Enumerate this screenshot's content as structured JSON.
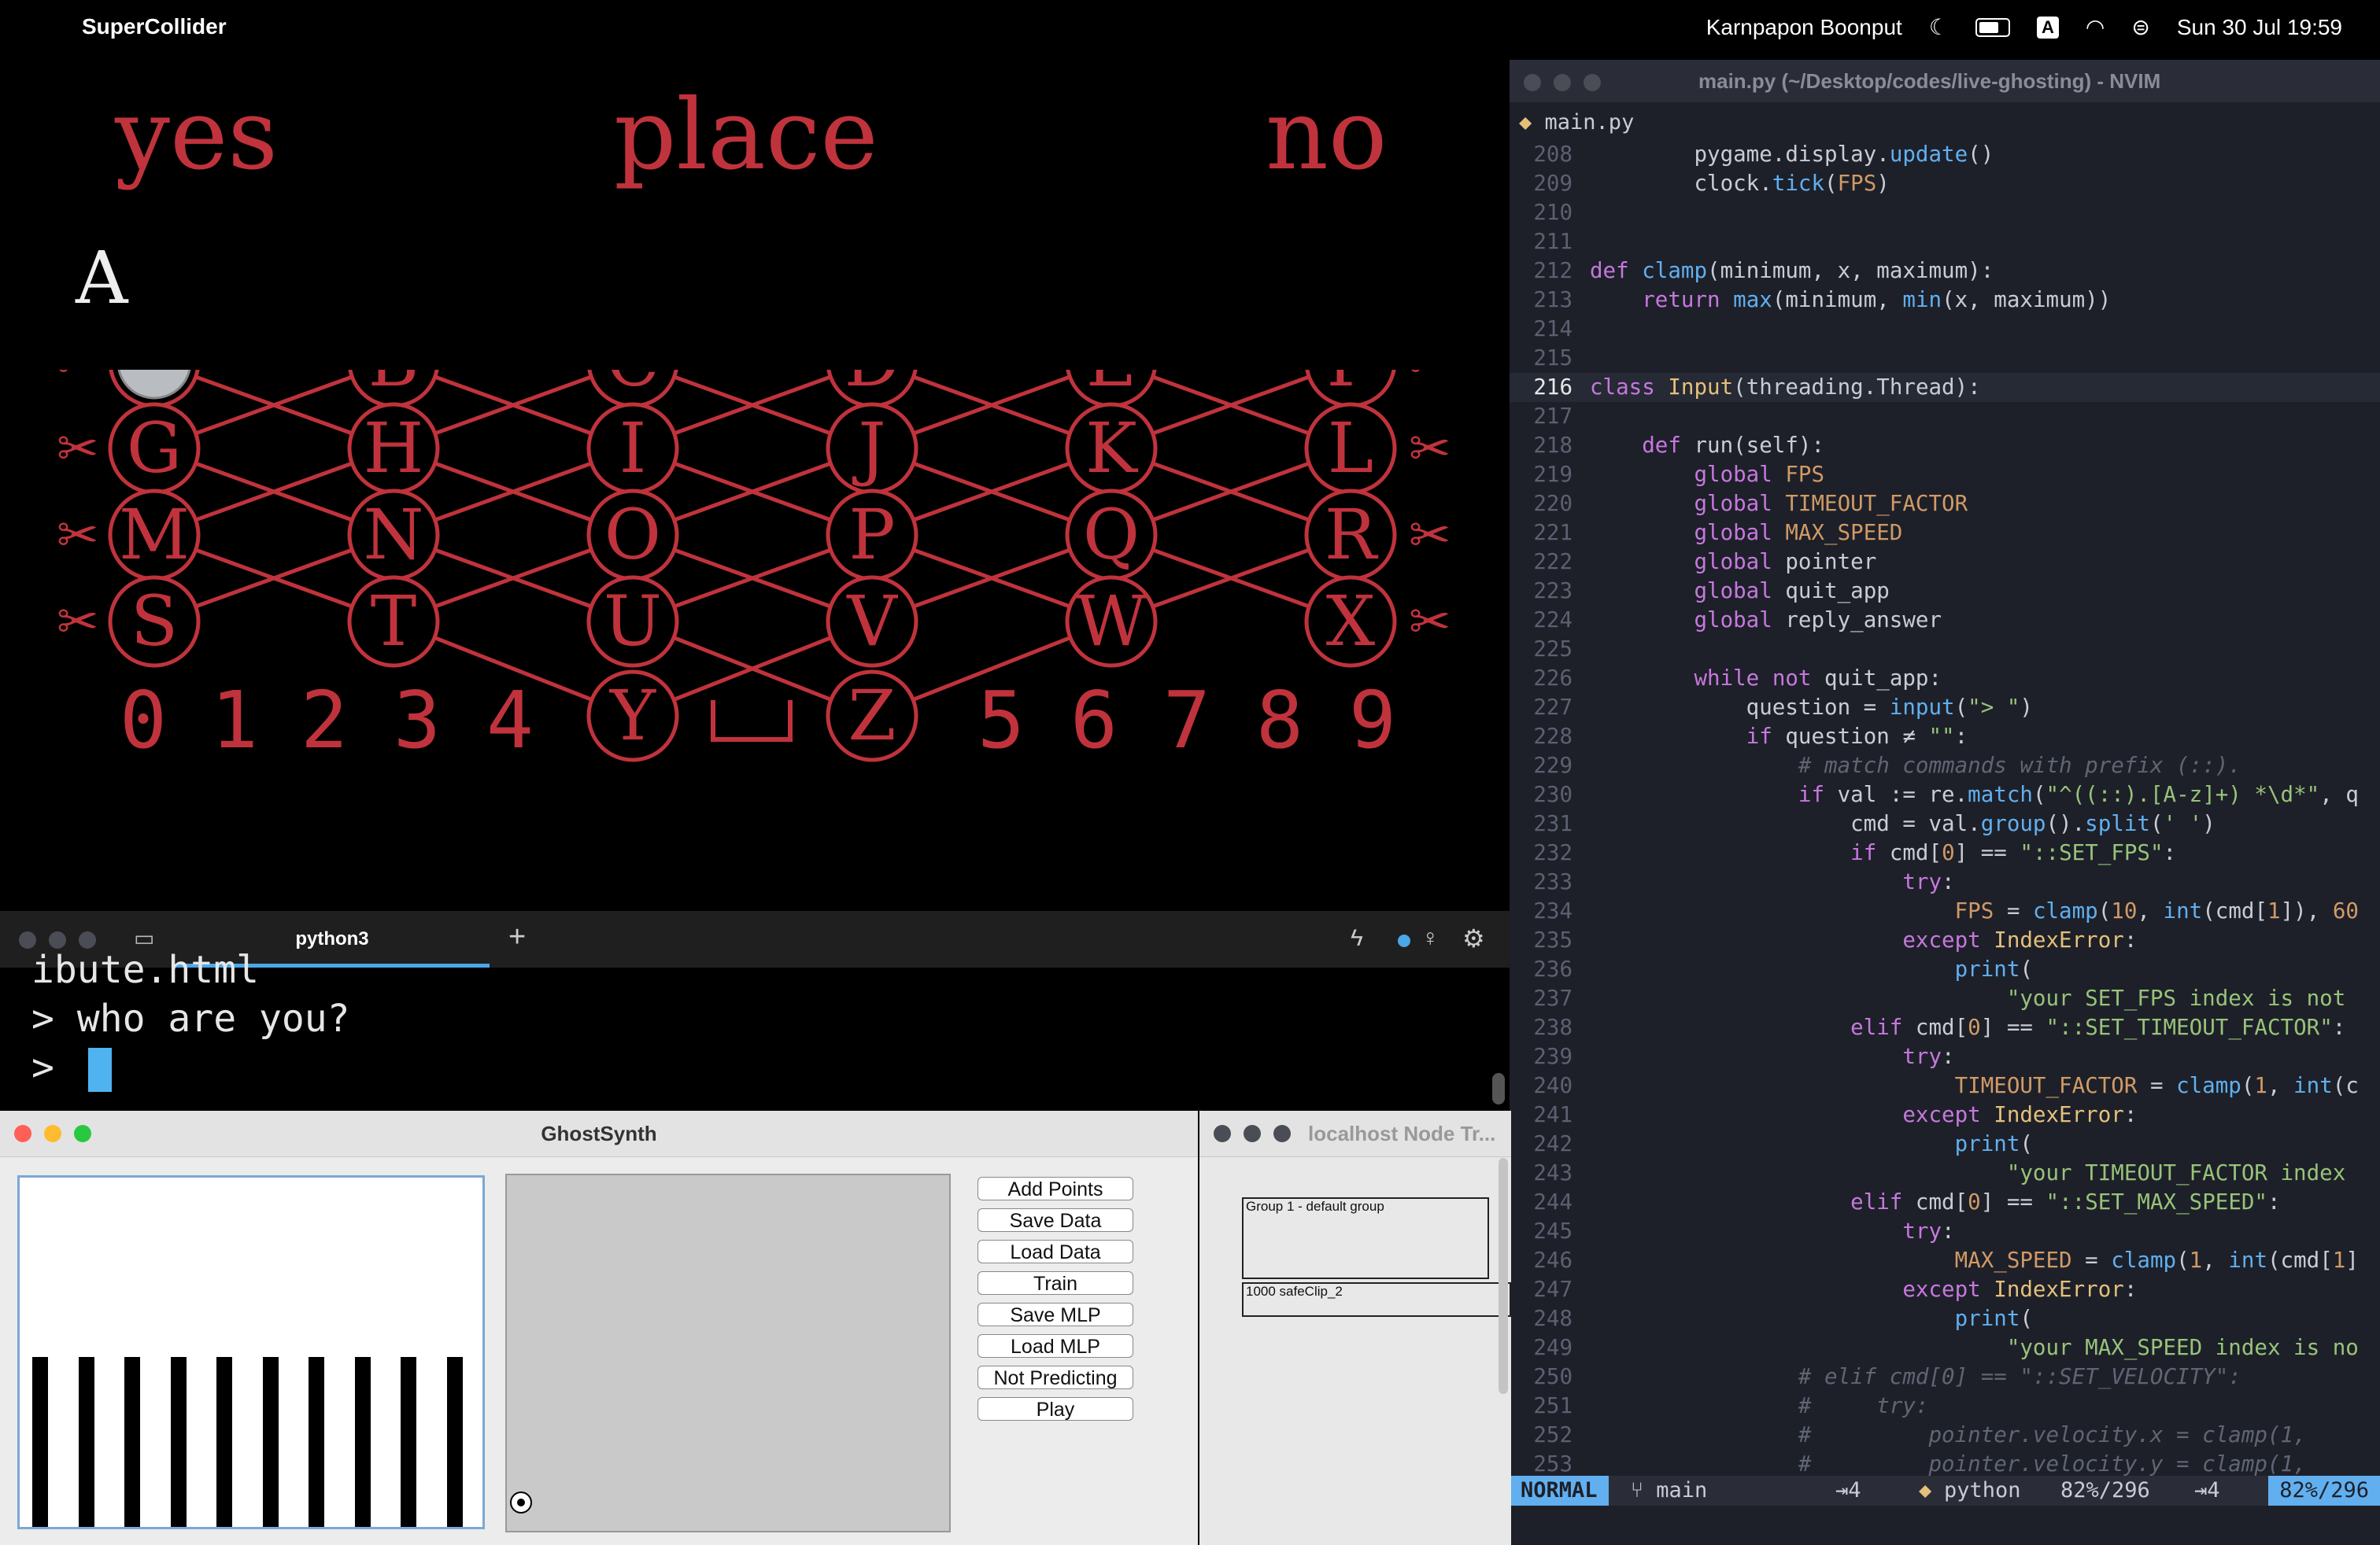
{
  "menubar": {
    "app_name": "SuperCollider",
    "user": "Karnpapon Boonput",
    "keyboard_layout": "A",
    "datetime": "Sun 30 Jul  19:59"
  },
  "game": {
    "words": [
      "yes",
      "place",
      "no"
    ],
    "current_letter": "A",
    "letter_rows": [
      [
        "A",
        "B",
        "C",
        "D",
        "E",
        "F"
      ],
      [
        "G",
        "H",
        "I",
        "J",
        "K",
        "L"
      ],
      [
        "M",
        "N",
        "O",
        "P",
        "Q",
        "R"
      ],
      [
        "S",
        "T",
        "U",
        "V",
        "W",
        "X"
      ]
    ],
    "digits_left": [
      "0",
      "1",
      "2",
      "3",
      "4"
    ],
    "bottom_letters": [
      "Y",
      "Z"
    ],
    "digits_right": [
      "5",
      "6",
      "7",
      "8",
      "9"
    ],
    "accent_color": "#c0333c"
  },
  "nvim": {
    "window_title": "main.py (~/Desktop/codes/live-ghosting) - NVIM",
    "tab_name": "main.py",
    "lines": [
      {
        "n": "208",
        "code": "        pygame.display.update()"
      },
      {
        "n": "209",
        "code": "        clock.tick(FPS)"
      },
      {
        "n": "210",
        "code": ""
      },
      {
        "n": "211",
        "code": ""
      },
      {
        "n": "212",
        "code": "def clamp(minimum, x, maximum):"
      },
      {
        "n": "213",
        "code": "    return max(minimum, min(x, maximum))"
      },
      {
        "n": "214",
        "code": ""
      },
      {
        "n": "215",
        "code": ""
      },
      {
        "n": "216",
        "code": "class Input(threading.Thread):"
      },
      {
        "n": "217",
        "code": ""
      },
      {
        "n": "218",
        "code": "    def run(self):"
      },
      {
        "n": "219",
        "code": "        global FPS"
      },
      {
        "n": "220",
        "code": "        global TIMEOUT_FACTOR"
      },
      {
        "n": "221",
        "code": "        global MAX_SPEED"
      },
      {
        "n": "222",
        "code": "        global pointer"
      },
      {
        "n": "223",
        "code": "        global quit_app"
      },
      {
        "n": "224",
        "code": "        global reply_answer"
      },
      {
        "n": "225",
        "code": ""
      },
      {
        "n": "226",
        "code": "        while not quit_app:"
      },
      {
        "n": "227",
        "code": "            question = input(\"> \")"
      },
      {
        "n": "228",
        "code": "            if question ≠ \"\":"
      },
      {
        "n": "229",
        "code": "                # match commands with prefix (::)."
      },
      {
        "n": "230",
        "code": "                if val := re.match(\"^((::).[A-z]+) *\\d*\", q"
      },
      {
        "n": "231",
        "code": "                    cmd = val.group().split(' ')"
      },
      {
        "n": "232",
        "code": "                    if cmd[0] == \"::SET_FPS\":"
      },
      {
        "n": "233",
        "code": "                        try:"
      },
      {
        "n": "234",
        "code": "                            FPS = clamp(10, int(cmd[1]), 60"
      },
      {
        "n": "235",
        "code": "                        except IndexError:"
      },
      {
        "n": "236",
        "code": "                            print("
      },
      {
        "n": "237",
        "code": "                                \"your SET_FPS index is not"
      },
      {
        "n": "238",
        "code": "                    elif cmd[0] == \"::SET_TIMEOUT_FACTOR\":"
      },
      {
        "n": "239",
        "code": "                        try:"
      },
      {
        "n": "240",
        "code": "                            TIMEOUT_FACTOR = clamp(1, int(c"
      },
      {
        "n": "241",
        "code": "                        except IndexError:"
      },
      {
        "n": "242",
        "code": "                            print("
      },
      {
        "n": "243",
        "code": "                                \"your TIMEOUT_FACTOR index"
      },
      {
        "n": "244",
        "code": "                    elif cmd[0] == \"::SET_MAX_SPEED\":"
      },
      {
        "n": "245",
        "code": "                        try:"
      },
      {
        "n": "246",
        "code": "                            MAX_SPEED = clamp(1, int(cmd[1]"
      },
      {
        "n": "247",
        "code": "                        except IndexError:"
      },
      {
        "n": "248",
        "code": "                            print("
      },
      {
        "n": "249",
        "code": "                                \"your MAX_SPEED index is no"
      },
      {
        "n": "250",
        "code": "                # elif cmd[0] == \"::SET_VELOCITY\":"
      },
      {
        "n": "251",
        "code": "                #     try:"
      },
      {
        "n": "252",
        "code": "                #         pointer.velocity.x = clamp(1,"
      },
      {
        "n": "253",
        "code": "                #         pointer.velocity.y = clamp(1,"
      }
    ],
    "status": {
      "mode": "NORMAL",
      "branch": "main",
      "indent": "⇥4",
      "filetype": "python",
      "progress": "82%/296",
      "indent2": "⇥4",
      "position": "82%/296"
    }
  },
  "terminal": {
    "tab_label": "python3",
    "new_tab": "+",
    "lines": [
      "ibute.html",
      "> who are you?",
      "> "
    ]
  },
  "ghostsynth": {
    "title": "GhostSynth",
    "buttons": [
      "Add Points",
      "Save Data",
      "Load Data",
      "Train",
      "Save MLP",
      "Load MLP",
      "Not Predicting",
      "Play"
    ]
  },
  "node_tree": {
    "title": "localhost Node Tr...",
    "group_label": "Group 1 - default group",
    "synth_label": "1000 safeClip_2"
  }
}
